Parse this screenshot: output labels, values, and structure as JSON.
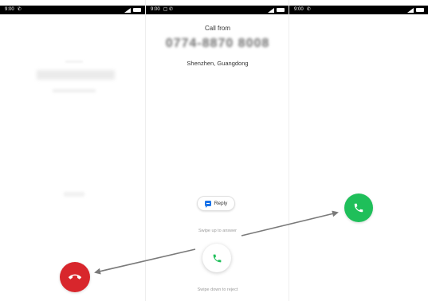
{
  "screens": {
    "left": {
      "status_time": "9:00"
    },
    "middle": {
      "status_time": "9:00",
      "call_from_label": "Call from",
      "caller_number": "0774-8870 8008",
      "caller_location": "Shenzhen, Guangdong",
      "reply_label": "Reply",
      "swipe_up_hint": "Swipe up to answer",
      "swipe_down_hint": "Swipe down to reject"
    },
    "right": {
      "status_time": "9:00"
    }
  },
  "icons": {
    "answer": "phone-icon",
    "decline": "phone-hangup-icon",
    "reply": "message-icon"
  },
  "colors": {
    "answer_button": "#1fbf5a",
    "decline_button": "#d8262c",
    "reply_icon": "#1a73e8",
    "arrow": "#7a7a7a"
  }
}
